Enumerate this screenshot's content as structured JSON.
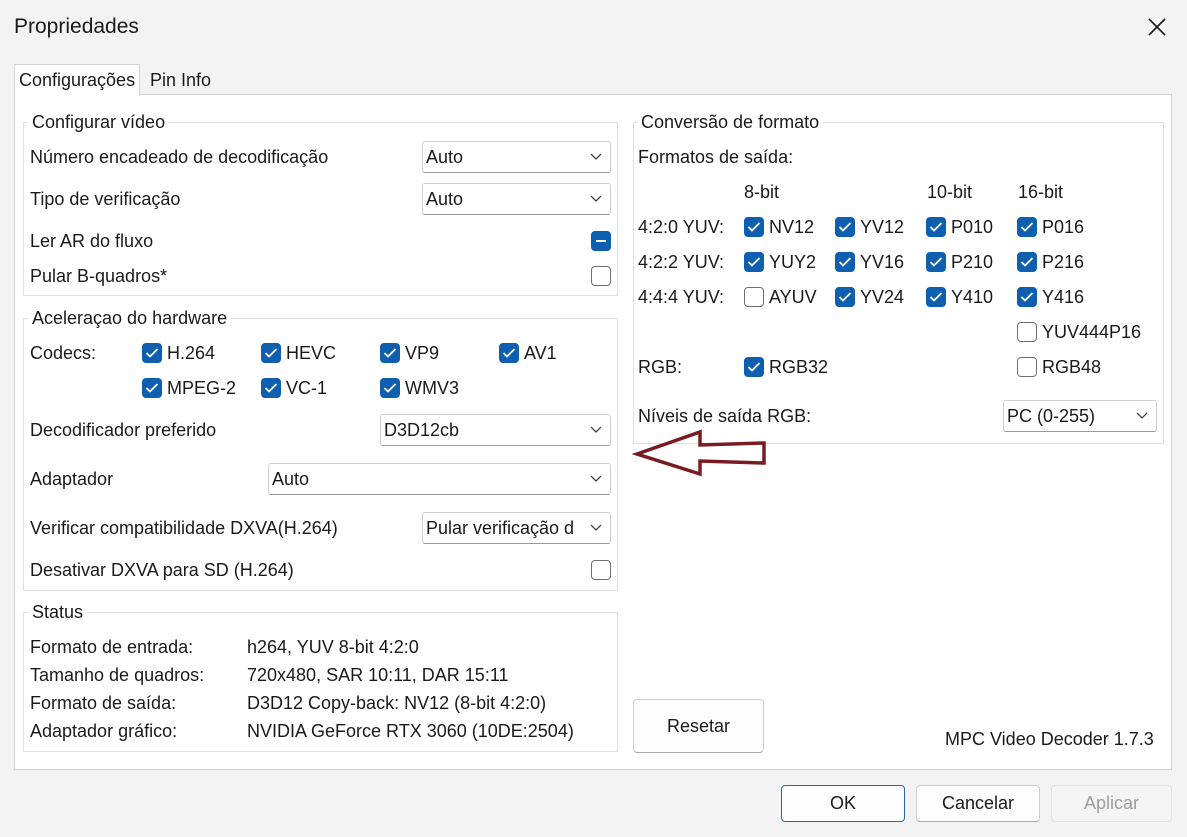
{
  "window": {
    "title": "Propriedades"
  },
  "tabs": [
    {
      "label": "Configurações"
    },
    {
      "label": "Pin Info"
    }
  ],
  "video": {
    "title": "Configurar vídeo",
    "threads_label": "Número encadeado de decodificação",
    "threads_value": "Auto",
    "check_label": "Tipo de verificação",
    "check_value": "Auto",
    "ar_label": "Ler AR do fluxo",
    "skip_label": "Pular B-quadros*"
  },
  "hw": {
    "title": "Aceleraçao do hardware",
    "codecs_label": "Codecs:",
    "codecs": [
      "H.264",
      "HEVC",
      "VP9",
      "AV1",
      "MPEG-2",
      "VC-1",
      "WMV3"
    ],
    "decoder_label": "Decodificador preferido",
    "decoder_value": "D3D12cb",
    "adapter_label": "Adaptador",
    "adapter_value": "Auto",
    "compat_label": "Verificar compatibilidade DXVA(H.264)",
    "compat_value": "Pular verificação d",
    "disable_sd_label": "Desativar DXVA para SD (H.264)"
  },
  "status": {
    "title": "Status",
    "rows": [
      {
        "label": "Formato de entrada:",
        "value": "h264, YUV 8-bit 4:2:0"
      },
      {
        "label": "Tamanho de quadros:",
        "value": "720x480, SAR 10:11, DAR 15:11"
      },
      {
        "label": "Formato de saída:",
        "value": "D3D12 Copy-back: NV12 (8-bit 4:2:0)"
      },
      {
        "label": "Adaptador gráfico:",
        "value": "NVIDIA GeForce RTX 3060 (10DE:2504)"
      }
    ]
  },
  "conv": {
    "title": "Conversão de formato",
    "formats_label": "Formatos de saída:",
    "col_8bit": "8-bit",
    "col_10bit": "10-bit",
    "col_16bit": "16-bit",
    "row_420": "4:2:0 YUV:",
    "row_422": "4:2:2 YUV:",
    "row_444": "4:4:4 YUV:",
    "row_rgb": "RGB:",
    "f": {
      "nv12": "NV12",
      "yv12": "YV12",
      "p010": "P010",
      "p016": "P016",
      "yuy2": "YUY2",
      "yv16": "YV16",
      "p210": "P210",
      "p216": "P216",
      "ayuv": "AYUV",
      "yv24": "YV24",
      "y410": "Y410",
      "y416": "Y416",
      "yuv444p16": "YUV444P16",
      "rgb32": "RGB32",
      "rgb48": "RGB48"
    },
    "levels_label": "Níveis de saída RGB:",
    "levels_value": "PC (0-255)"
  },
  "buttons": {
    "reset": "Resetar",
    "ok": "OK",
    "cancel": "Cancelar",
    "apply": "Aplicar"
  },
  "version": "MPC Video Decoder 1.7.3",
  "colors": {
    "accent": "#0f5fb1",
    "arrow": "#7a1b22"
  }
}
